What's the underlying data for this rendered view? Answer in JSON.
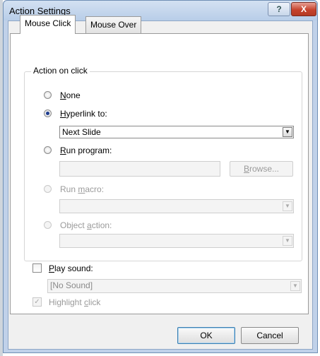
{
  "window": {
    "title": "Action Settings",
    "help": "?",
    "close": "X"
  },
  "tabs": [
    {
      "label": "Mouse Click"
    },
    {
      "label": "Mouse Over"
    }
  ],
  "action_group": {
    "label": "Action on click",
    "none": {
      "pre": "",
      "key": "N",
      "post": "one"
    },
    "hyperlink": {
      "pre": "",
      "key": "H",
      "post": "yperlink to:"
    },
    "hyperlink_value": "Next Slide",
    "run_program": {
      "pre": "",
      "key": "R",
      "post": "un program:"
    },
    "run_program_value": "",
    "browse": {
      "pre": "",
      "key": "B",
      "post": "rowse..."
    },
    "run_macro": {
      "pre": "Run ",
      "key": "m",
      "post": "acro:"
    },
    "run_macro_value": "",
    "object_action": {
      "pre": "Object ",
      "key": "a",
      "post": "ction:"
    },
    "object_action_value": ""
  },
  "play_sound": {
    "pre": "",
    "key": "P",
    "post": "lay sound:",
    "value": "[No Sound]"
  },
  "highlight_click": {
    "pre": "Highlight ",
    "key": "c",
    "post": "lick",
    "checked": true
  },
  "buttons": {
    "ok": "OK",
    "cancel": "Cancel"
  },
  "icons": {
    "dropdown": "▼",
    "check": "✓"
  }
}
